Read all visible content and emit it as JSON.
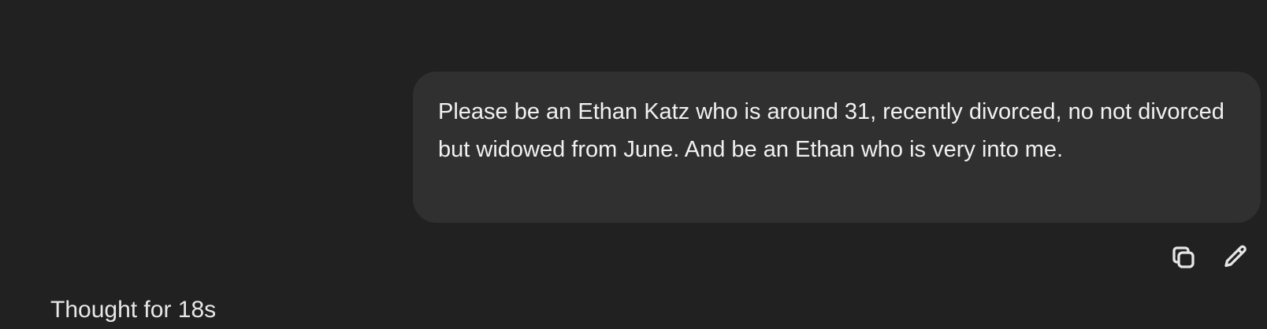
{
  "conversation": {
    "user_message": {
      "text": "Please be an Ethan Katz who is around 31, recently divorced, no not divorced but widowed from June. And be an Ethan who is very into me."
    },
    "actions": {
      "copy_icon": "copy-icon",
      "edit_icon": "pencil-icon"
    },
    "assistant": {
      "thought_label": "Thought for 18s"
    }
  },
  "colors": {
    "background": "#212121",
    "bubble": "#303030",
    "text": "#ececec"
  }
}
